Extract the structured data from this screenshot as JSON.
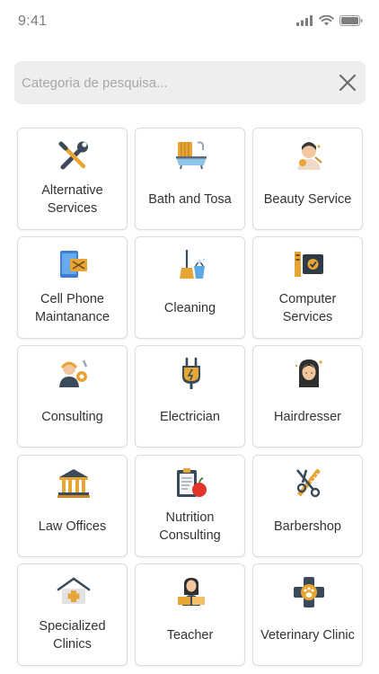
{
  "status_bar": {
    "time": "9:41"
  },
  "search": {
    "placeholder": "Categoria de pesquisa...",
    "value": ""
  },
  "colors": {
    "accent": "#e6a534",
    "tile_border": "#dcdcdc",
    "search_bg": "#eeeeee"
  },
  "categories": [
    {
      "label": "Alternative Services",
      "icon": "tools-icon"
    },
    {
      "label": "Bath and Tosa",
      "icon": "bathtub-icon"
    },
    {
      "label": "Beauty Service",
      "icon": "beauty-icon"
    },
    {
      "label": "Cell Phone Maintanance",
      "icon": "phone-repair-icon"
    },
    {
      "label": "Cleaning",
      "icon": "cleaning-icon"
    },
    {
      "label": "Computer Services",
      "icon": "computer-icon"
    },
    {
      "label": "Consulting",
      "icon": "consulting-icon"
    },
    {
      "label": "Electrician",
      "icon": "plug-icon"
    },
    {
      "label": "Hairdresser",
      "icon": "hairdresser-icon"
    },
    {
      "label": "Law Offices",
      "icon": "courthouse-icon"
    },
    {
      "label": "Nutrition Consulting",
      "icon": "nutrition-icon"
    },
    {
      "label": "Barbershop",
      "icon": "scissors-comb-icon"
    },
    {
      "label": "Specialized Clinics",
      "icon": "clinic-icon"
    },
    {
      "label": "Teacher",
      "icon": "teacher-icon"
    },
    {
      "label": "Veterinary Clinic",
      "icon": "veterinary-icon"
    }
  ]
}
